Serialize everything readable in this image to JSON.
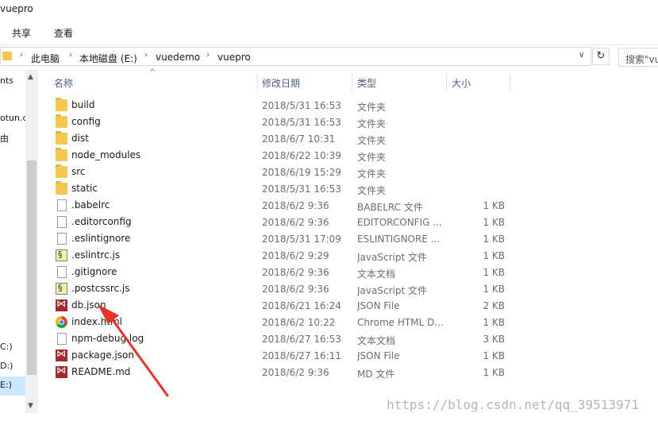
{
  "window": {
    "title": "vuepro"
  },
  "ribbon": {
    "tabs": [
      "共享",
      "查看"
    ]
  },
  "address": {
    "crumbs": [
      "此电脑",
      "本地磁盘 (E:)",
      "vuedemo",
      "vuepro"
    ],
    "refresh_glyph": "↻",
    "dropdown_glyph": "∨"
  },
  "search": {
    "placeholder": "搜索\"vu"
  },
  "nav": {
    "items": [
      "nts",
      "otun.c",
      "由",
      "C:)",
      "D:)",
      "E:)"
    ]
  },
  "columns": {
    "name": "名称",
    "date": "修改日期",
    "type": "类型",
    "size": "大小"
  },
  "files": [
    {
      "name": "build",
      "date": "2018/5/31 16:53",
      "type": "文件夹",
      "size": "",
      "icon": "folder-icon"
    },
    {
      "name": "config",
      "date": "2018/5/31 16:53",
      "type": "文件夹",
      "size": "",
      "icon": "folder-icon"
    },
    {
      "name": "dist",
      "date": "2018/6/7 10:31",
      "type": "文件夹",
      "size": "",
      "icon": "folder-icon"
    },
    {
      "name": "node_modules",
      "date": "2018/6/22 10:39",
      "type": "文件夹",
      "size": "",
      "icon": "folder-icon"
    },
    {
      "name": "src",
      "date": "2018/6/19 15:29",
      "type": "文件夹",
      "size": "",
      "icon": "folder-icon"
    },
    {
      "name": "static",
      "date": "2018/5/31 16:53",
      "type": "文件夹",
      "size": "",
      "icon": "folder-icon"
    },
    {
      "name": ".babelrc",
      "date": "2018/6/2 9:36",
      "type": "BABELRC 文件",
      "size": "1 KB",
      "icon": "blank-file-icon"
    },
    {
      "name": ".editorconfig",
      "date": "2018/6/2 9:36",
      "type": "EDITORCONFIG ...",
      "size": "1 KB",
      "icon": "blank-file-icon"
    },
    {
      "name": ".eslintignore",
      "date": "2018/5/31 17:09",
      "type": "ESLINTIGNORE ...",
      "size": "1 KB",
      "icon": "blank-file-icon"
    },
    {
      "name": ".eslintrc.js",
      "date": "2018/6/2 9:29",
      "type": "JavaScript 文件",
      "size": "1 KB",
      "icon": "javascript-file-icon"
    },
    {
      "name": ".gitignore",
      "date": "2018/6/2 9:36",
      "type": "文本文档",
      "size": "1 KB",
      "icon": "text-file-icon"
    },
    {
      "name": ".postcssrc.js",
      "date": "2018/6/2 9:36",
      "type": "JavaScript 文件",
      "size": "1 KB",
      "icon": "javascript-file-icon"
    },
    {
      "name": "db.json",
      "date": "2018/6/21 16:24",
      "type": "JSON File",
      "size": "2 KB",
      "icon": "visual-studio-file-icon"
    },
    {
      "name": "index.html",
      "date": "2018/6/2 10:22",
      "type": "Chrome HTML D...",
      "size": "1 KB",
      "icon": "chrome-html-icon"
    },
    {
      "name": "npm-debug.log",
      "date": "2018/6/27 16:53",
      "type": "文本文档",
      "size": "3 KB",
      "icon": "text-file-icon"
    },
    {
      "name": "package.json",
      "date": "2018/6/27 16:11",
      "type": "JSON File",
      "size": "1 KB",
      "icon": "visual-studio-file-icon"
    },
    {
      "name": "README.md",
      "date": "2018/6/2 9:36",
      "type": "MD 文件",
      "size": "1 KB",
      "icon": "visual-studio-file-icon"
    }
  ],
  "watermark": "https://blog.csdn.net/qq_39513971",
  "colors": {
    "folder": "#f6c84f",
    "selection": "#cce8ff",
    "arrow": "#e8322a",
    "header_text": "#4c607a"
  }
}
